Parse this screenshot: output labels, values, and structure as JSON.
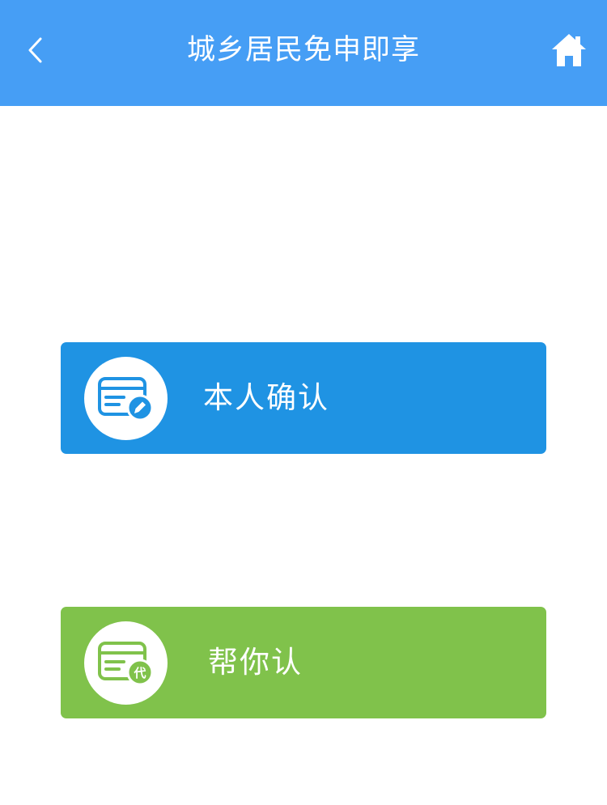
{
  "header": {
    "title": "城乡居民免申即享",
    "back_icon": "chevron-left-icon",
    "home_icon": "home-icon",
    "background_color": "#469ef5"
  },
  "actions": [
    {
      "label": "本人确认",
      "icon": "id-card-edit-icon",
      "color": "#1f93e3"
    },
    {
      "label": "帮你认",
      "icon": "id-card-proxy-icon",
      "badge_text": "代",
      "color": "#80c24b"
    }
  ]
}
